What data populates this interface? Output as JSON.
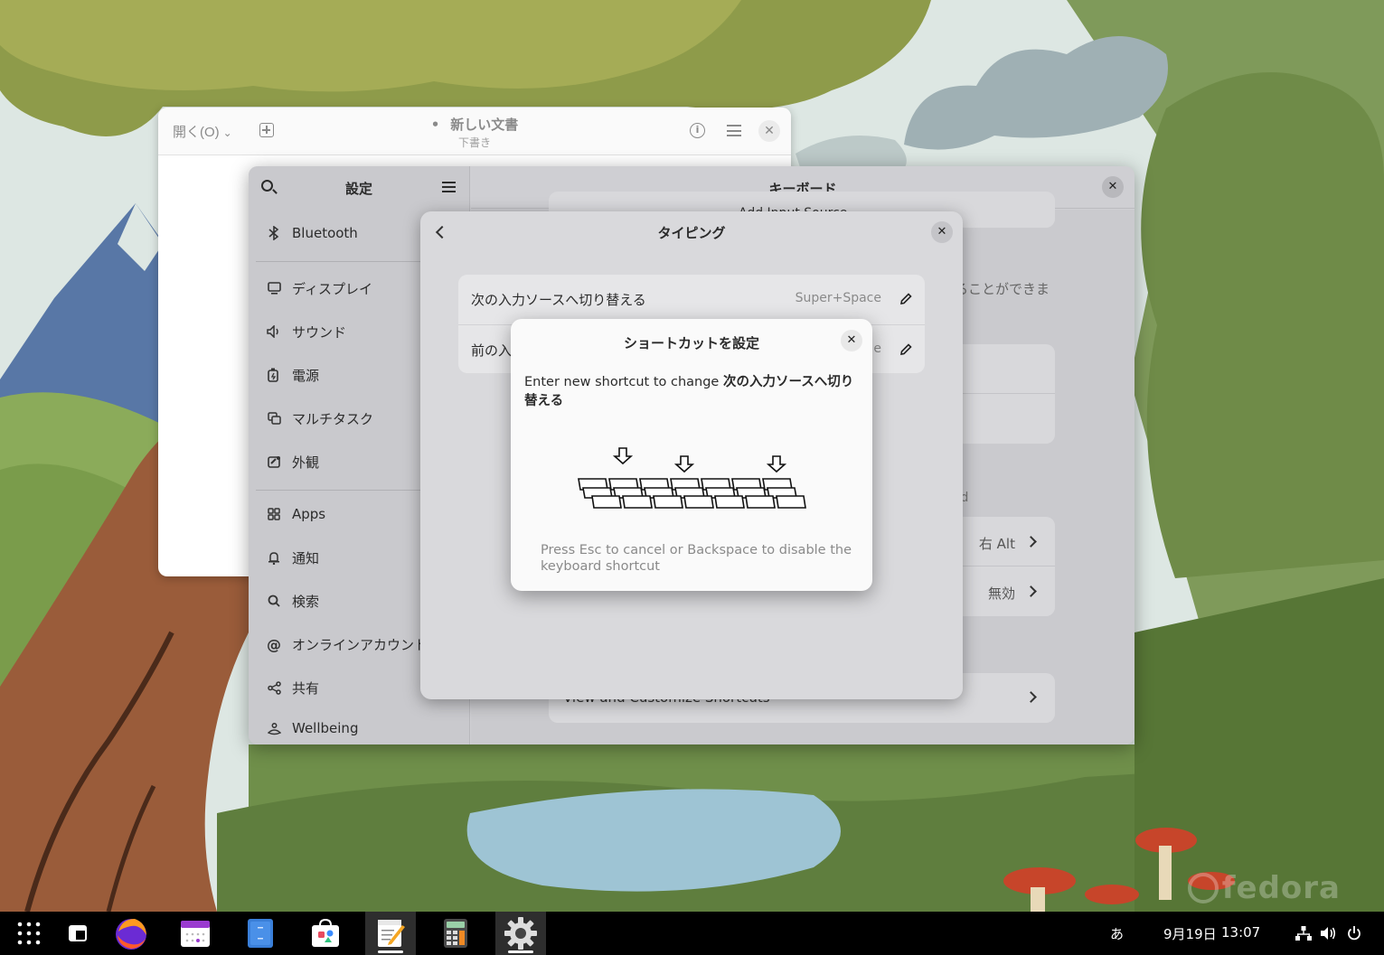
{
  "editor": {
    "open_label": "開く(O)",
    "title": "新しい文書",
    "subtitle": "下書き",
    "modified_dot": "•"
  },
  "settings": {
    "sidebar_title": "設定",
    "main_title": "キーボード",
    "sidebar_items": [
      {
        "label": "Bluetooth",
        "icon": "bluetooth-icon"
      },
      {
        "label": "ディスプレイ",
        "icon": "display-icon"
      },
      {
        "label": "サウンド",
        "icon": "sound-icon"
      },
      {
        "label": "電源",
        "icon": "power-icon"
      },
      {
        "label": "マルチタスク",
        "icon": "multitasking-icon"
      },
      {
        "label": "外観",
        "icon": "appearance-icon"
      },
      {
        "label": "Apps",
        "icon": "apps-icon"
      },
      {
        "label": "通知",
        "icon": "bell-icon"
      },
      {
        "label": "検索",
        "icon": "search-icon"
      },
      {
        "label": "オンラインアカウント",
        "icon": "at-icon"
      },
      {
        "label": "共有",
        "icon": "share-icon"
      },
      {
        "label": "Wellbeing",
        "icon": "wellbeing-icon"
      }
    ],
    "background": {
      "add_input_source": "Add Input Source",
      "partial_desc": "ることができま",
      "partial_label": "rd",
      "alt_char_value": "右 Alt",
      "compose_value": "無効",
      "view_shortcuts": "View and Customize Shortcuts"
    }
  },
  "typing": {
    "title": "タイピング",
    "rows": [
      {
        "label": "次の入力ソースへ切り替える",
        "value": "Super+Space"
      },
      {
        "label": "前の入",
        "value": "e"
      }
    ]
  },
  "shortcut_dialog": {
    "title": "ショートカットを設定",
    "desc_prefix": "Enter new shortcut to change ",
    "desc_target": "次の入力ソースへ切り替える",
    "hint": "Press Esc to cancel or Backspace to disable the keyboard shortcut"
  },
  "taskbar": {
    "apps": [
      "app-grid-icon",
      "window-overview-icon",
      "firefox-icon",
      "calendar-icon",
      "file-manager-icon",
      "software-icon",
      "text-editor-icon",
      "calculator-icon",
      "settings-icon"
    ],
    "input_method": "あ",
    "date": "9月19日",
    "time": "13:07"
  },
  "wallpaper": {
    "brand": "fedora"
  }
}
